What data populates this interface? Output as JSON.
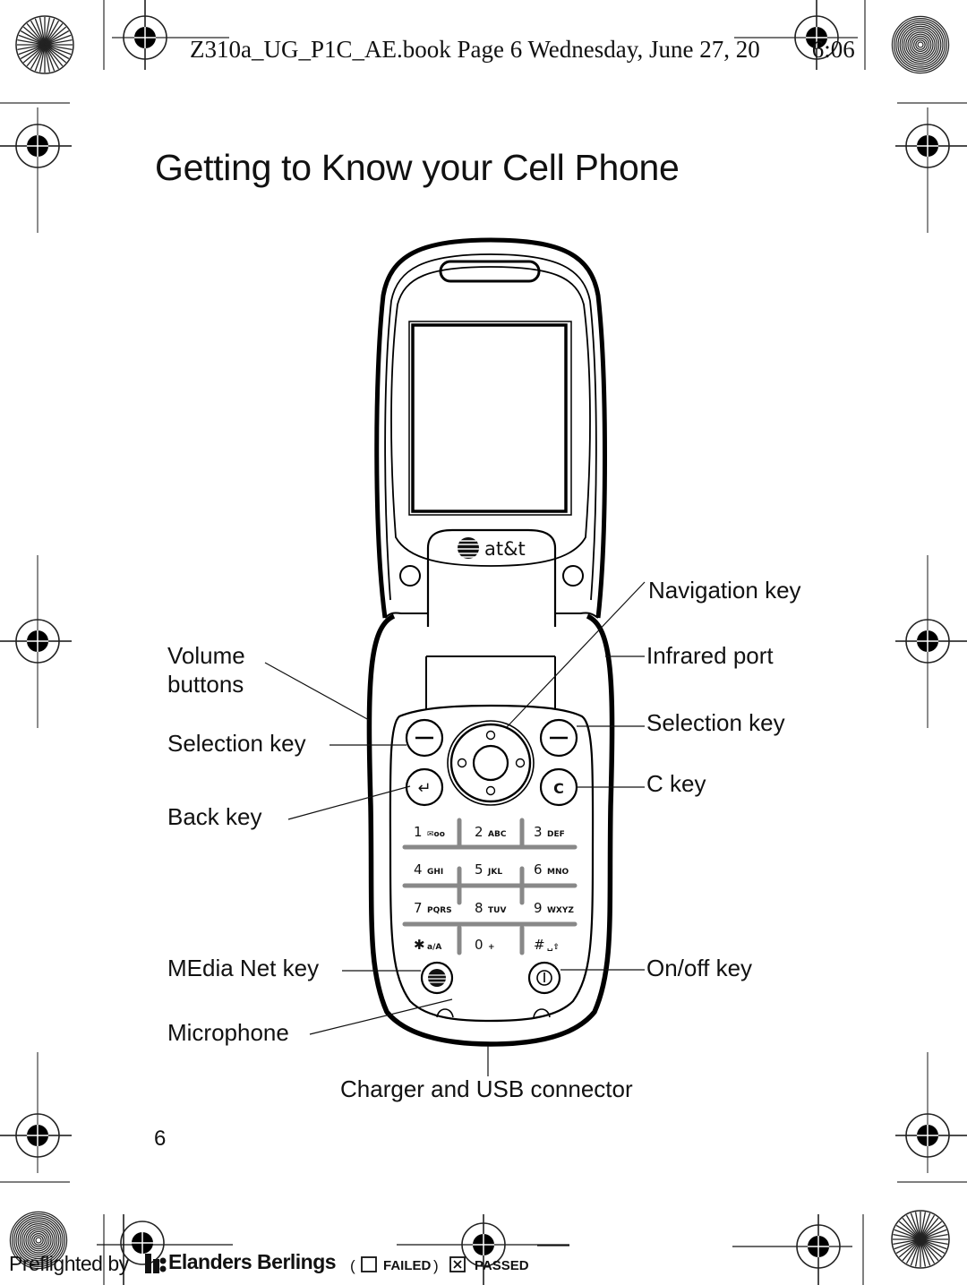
{
  "header": {
    "file_line": "Z310a_UG_P1C_AE.book  Page 6  Wednesday, June 27, 20",
    "time_fragment": "6:06"
  },
  "page": {
    "title": "Getting to Know your Cell Phone",
    "page_number": "6"
  },
  "phone": {
    "brand_logo": "at&t",
    "soft_keys": [
      "—",
      "—"
    ],
    "back_key_symbol": "↵",
    "c_key_symbol": "C",
    "keypad": [
      {
        "digit": "1",
        "letters": "✉oo"
      },
      {
        "digit": "2",
        "letters": "ABC"
      },
      {
        "digit": "3",
        "letters": "DEF"
      },
      {
        "digit": "4",
        "letters": "GHI"
      },
      {
        "digit": "5",
        "letters": "JKL"
      },
      {
        "digit": "6",
        "letters": "MNO"
      },
      {
        "digit": "7",
        "letters": "PQRS"
      },
      {
        "digit": "8",
        "letters": "TUV"
      },
      {
        "digit": "9",
        "letters": "WXYZ"
      },
      {
        "digit": "✱",
        "letters": "a/A"
      },
      {
        "digit": "0",
        "letters": "+"
      },
      {
        "digit": "#",
        "letters": "␣⇧"
      }
    ],
    "power_symbol": "⏻"
  },
  "callouts": {
    "left": {
      "volume_line1": "Volume",
      "volume_line2": "buttons",
      "selection_key": "Selection key",
      "back_key": "Back key",
      "medianet_key": "MEdia Net key",
      "microphone": "Microphone"
    },
    "right": {
      "navigation_key": "Navigation key",
      "infrared_port": "Infrared port",
      "selection_key": "Selection key",
      "c_key": "C key",
      "onoff_key": "On/off key"
    },
    "bottom": {
      "charger": "Charger and USB connector"
    }
  },
  "footer": {
    "preflighted_by": "Preflighted by",
    "brand": "Elanders Berlings",
    "failed_label": "FAILED",
    "passed_label": "PASSED",
    "failed_checked": false,
    "passed_checked": true,
    "open_paren": "(",
    "close_paren": ")"
  },
  "icons": {
    "registration_mark": "crosshair-target-icon",
    "starburst": "starburst-icon",
    "concentric": "concentric-circles-icon"
  }
}
